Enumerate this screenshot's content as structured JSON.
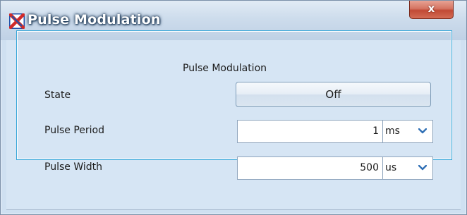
{
  "window": {
    "title": "Pulse Modulation",
    "icon": "app-logo-icon",
    "close_label": "x",
    "colors": {
      "title_bar": "#cddcec",
      "close_button": "#c14a35",
      "client_bg": "#d6e5f4",
      "group_border": "#39a7d9"
    }
  },
  "group": {
    "title": "Pulse Modulation"
  },
  "state": {
    "label": "State",
    "button_label": "Off"
  },
  "pulse_period": {
    "label": "Pulse Period",
    "value": "1",
    "unit": "ms",
    "unit_icon": "chevron-down-icon"
  },
  "pulse_width": {
    "label": "Pulse Width",
    "value": "500",
    "unit": "us",
    "unit_icon": "chevron-down-icon"
  }
}
